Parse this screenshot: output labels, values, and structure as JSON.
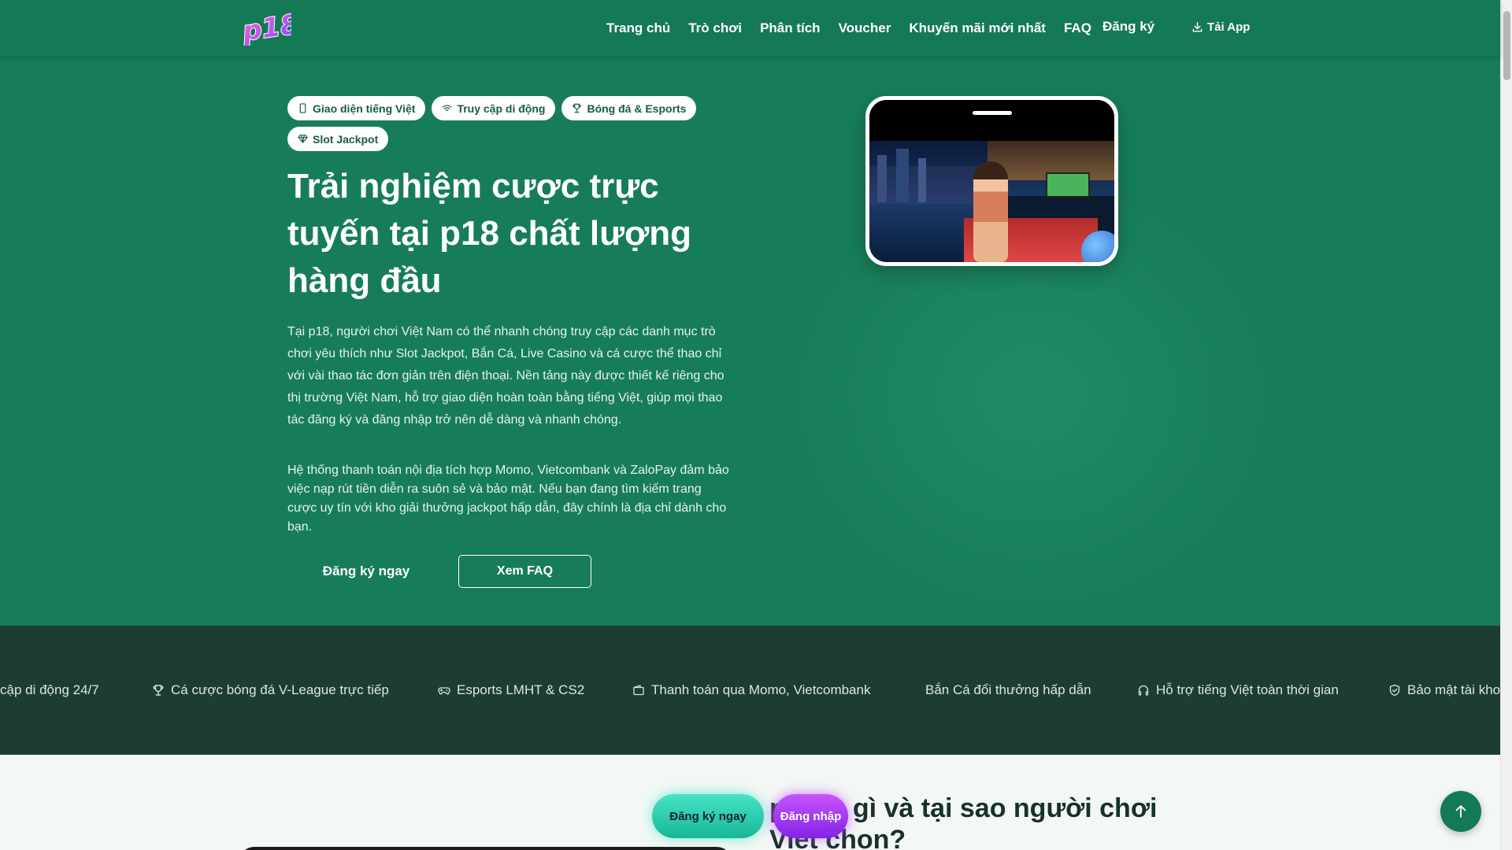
{
  "header": {
    "logo_text": "p18",
    "nav": [
      "Trang chủ",
      "Trò chơi",
      "Phân tích",
      "Voucher",
      "Khuyến mãi mới nhất",
      "FAQ"
    ],
    "register_label": "Đăng ký",
    "app_label": "Tải App"
  },
  "hero": {
    "badges": [
      {
        "label": "Giao diện tiếng Việt",
        "icon": "phone-icon"
      },
      {
        "label": "Truy cập di động",
        "icon": "wifi-icon"
      },
      {
        "label": "Bóng đá & Esports",
        "icon": "trophy-icon"
      },
      {
        "label": "Slot Jackpot",
        "icon": "diamond-icon"
      }
    ],
    "title": "Trải nghiệm cược trực tuyến tại p18 chất lượng hàng đầu",
    "paragraph_1": "Tại p18, người chơi Việt Nam có thể nhanh chóng truy cập các danh mục trò chơi yêu thích như Slot Jackpot, Bắn Cá, Live Casino và cá cược thể thao chỉ với vài thao tác đơn giản trên điện thoại. Nền tảng này được thiết kế riêng cho thị trường Việt Nam, hỗ trợ giao diện hoàn toàn bằng tiếng Việt, giúp mọi thao tác đăng ký và đăng nhập trở nên dễ dàng và nhanh chóng.",
    "paragraph_2": "Hệ thống thanh toán nội địa tích hợp Momo, Vietcombank và ZaloPay đảm bảo việc nạp rút tiền diễn ra suôn sẻ và bảo mật. Nếu bạn đang tìm kiếm trang cược uy tín với kho giải thưởng jackpot hấp dẫn, đây chính là địa chỉ dành cho bạn.",
    "register_button": "Đăng ký ngay",
    "faq_button": "Xem FAQ"
  },
  "ticker": [
    {
      "label": "cập di động 24/7",
      "icon": ""
    },
    {
      "label": "Cá cược bóng đá V-League trực tiếp",
      "icon": "trophy-icon"
    },
    {
      "label": "Esports LMHT & CS2",
      "icon": "gamepad-icon"
    },
    {
      "label": "Thanh toán qua Momo, Vietcombank",
      "icon": "wallet-icon"
    },
    {
      "label": "Bắn Cá đổi thưởng hấp dẫn",
      "icon": ""
    },
    {
      "label": "Hỗ trợ tiếng Việt toàn thời gian",
      "icon": "headphones-icon"
    },
    {
      "label": "Bảo mật tài kho",
      "icon": "shield-icon"
    }
  ],
  "section": {
    "title": "p18 là gì và tại sao người chơi Việt chọn?"
  },
  "floating": {
    "register_label": "Đăng ký ngay",
    "login_label": "Đăng nhập"
  },
  "colors": {
    "header_bg": "#147a55",
    "hero_bg": "#177d59",
    "ticker_bg": "#1d3c34",
    "register_glow": "#18b799",
    "login_glow": "#8422e6"
  }
}
